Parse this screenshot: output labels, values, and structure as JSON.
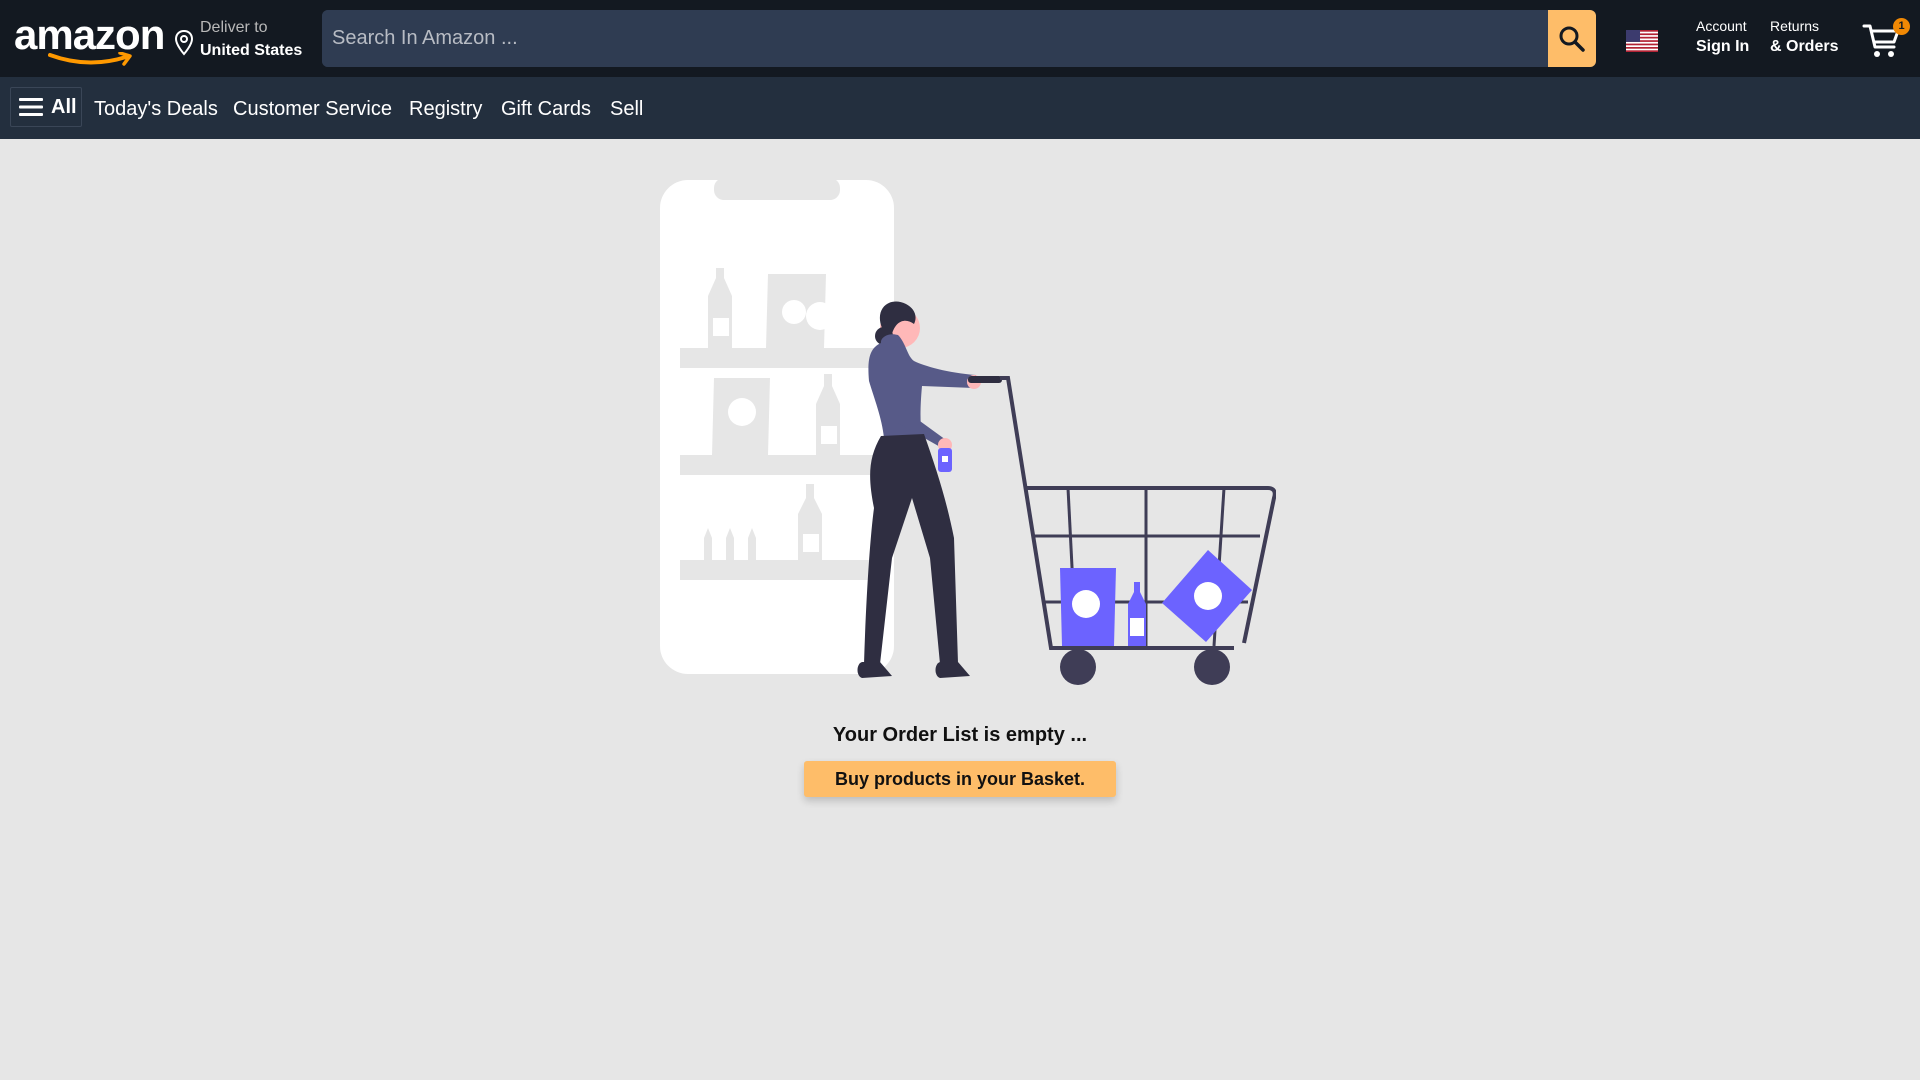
{
  "header": {
    "logo_text": "amazon",
    "deliver_line1": "Deliver to",
    "deliver_line2": "United States",
    "search_placeholder": "Search In Amazon ...",
    "account_line1": "Account",
    "account_line2": "Sign In",
    "returns_line1": "Returns",
    "returns_line2": "& Orders",
    "cart_count": "1"
  },
  "nav": {
    "all_label": "All",
    "items": [
      {
        "label": "Today's Deals"
      },
      {
        "label": "Customer Service"
      },
      {
        "label": "Registry"
      },
      {
        "label": "Gift Cards"
      },
      {
        "label": "Sell"
      }
    ]
  },
  "main": {
    "empty_message": "Your Order List is empty ...",
    "button_label": "Buy products in your Basket."
  },
  "colors": {
    "header_bg": "#131921",
    "nav_bg": "#232f3e",
    "accent": "#febd69",
    "page_bg": "#e6e6e6",
    "illustration_purple": "#6c63ff"
  },
  "icons": [
    "amazon-smile-icon",
    "location-pin-icon",
    "search-icon",
    "us-flag-icon",
    "cart-icon",
    "hamburger-menu-icon"
  ]
}
